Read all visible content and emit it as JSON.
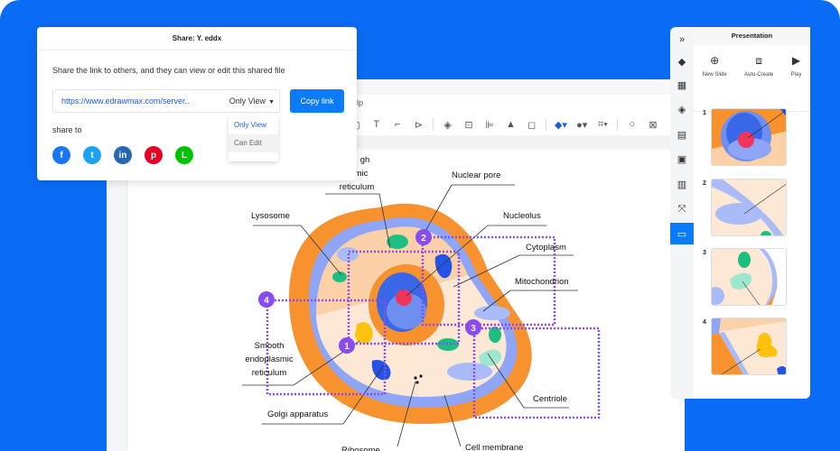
{
  "share_dialog": {
    "title": "Share: Y. eddx",
    "description": "Share the link to others, and they can view or edit this shared file",
    "link_url": "https://www.edrawmax.com/server..",
    "permission": "Only View",
    "copy_button": "Copy link",
    "permission_options": [
      "Only View",
      "Can Edit"
    ],
    "share_to_label": "share to",
    "socials": [
      {
        "name": "facebook",
        "glyph": "f",
        "color": "#1877f2"
      },
      {
        "name": "twitter",
        "glyph": "t",
        "color": "#1da1f2"
      },
      {
        "name": "linkedin",
        "glyph": "in",
        "color": "#2867b2"
      },
      {
        "name": "pinterest",
        "glyph": "p",
        "color": "#e60023"
      },
      {
        "name": "line",
        "glyph": "L",
        "color": "#00c300"
      }
    ]
  },
  "editor": {
    "menu_help": "elp"
  },
  "presentation": {
    "title": "Presentation",
    "actions": [
      {
        "label": "New Slide",
        "icon": "plus-circle-icon",
        "glyph": "⊕"
      },
      {
        "label": "Auto-Create",
        "icon": "auto-create-icon",
        "glyph": "⧈"
      },
      {
        "label": "Play",
        "icon": "play-icon",
        "glyph": "▶"
      }
    ],
    "slides": [
      "1",
      "2",
      "3",
      "4"
    ]
  },
  "diagram": {
    "labels": {
      "rough_er": [
        "gh",
        "asmic",
        "reticulum"
      ],
      "nuclear_pore": "Nuclear pore",
      "lysosome": "Lysosome",
      "nucleolus": "Nucleolus",
      "cytoplasm": "Cytoplasm",
      "mitochondrion": "Mitochondrion",
      "smooth_er": [
        "Smooth",
        "endoplasmic",
        "reticulum"
      ],
      "golgi": "Golgi apparatus",
      "centriole": "Centriole",
      "ribosome": "Ribosome",
      "cell_membrane": "Cell membrane"
    },
    "markers": [
      "1",
      "2",
      "3",
      "4"
    ]
  }
}
